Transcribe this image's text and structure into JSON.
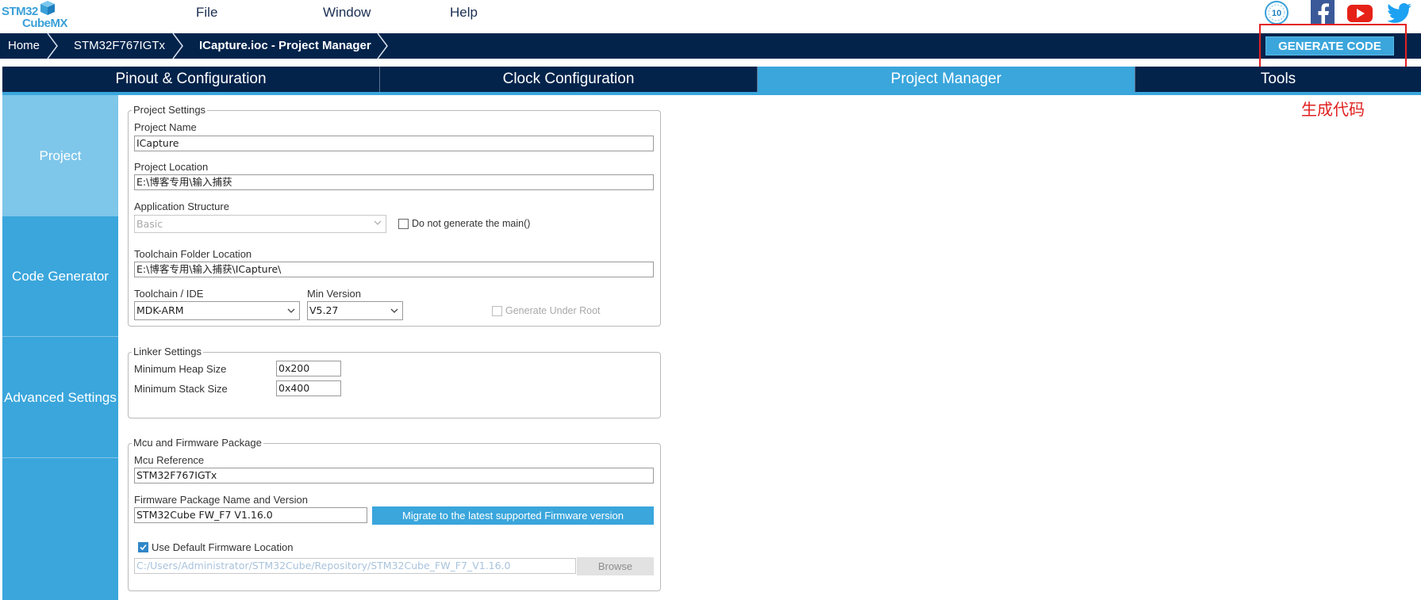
{
  "logo": {
    "line1": "STM32",
    "line2": "CubeMX"
  },
  "menu": {
    "file": "File",
    "window": "Window",
    "help": "Help"
  },
  "social": {
    "anniversary": "10",
    "facebook": "facebook-icon",
    "youtube": "youtube-icon",
    "twitter": "twitter-icon"
  },
  "breadcrumb": {
    "home": "Home",
    "mcu": "STM32F767IGTx",
    "project": "ICapture.ioc - Project Manager"
  },
  "generate_button": "GENERATE CODE",
  "annotation": "生成代码",
  "tabs": [
    "Pinout & Configuration",
    "Clock Configuration",
    "Project Manager",
    "Tools"
  ],
  "nav": [
    "Project",
    "Code Generator",
    "Advanced Settings"
  ],
  "project_settings": {
    "legend": "Project Settings",
    "name_label": "Project Name",
    "name_value": "ICapture",
    "location_label": "Project Location",
    "location_value": "E:\\博客专用\\输入捕获",
    "app_structure_label": "Application Structure",
    "app_structure_value": "Basic",
    "no_main_label": "Do not generate the main()",
    "toolchain_folder_label": "Toolchain Folder Location",
    "toolchain_folder_value": "E:\\博客专用\\输入捕获\\ICapture\\",
    "toolchain_label": "Toolchain / IDE",
    "toolchain_value": "MDK-ARM",
    "min_version_label": "Min Version",
    "min_version_value": "V5.27",
    "generate_root_label": "Generate Under Root"
  },
  "linker_settings": {
    "legend": "Linker Settings",
    "heap_label": "Minimum Heap Size",
    "heap_value": "0x200",
    "stack_label": "Minimum Stack Size",
    "stack_value": "0x400"
  },
  "firmware": {
    "legend": "Mcu and Firmware Package",
    "mcu_ref_label": "Mcu Reference",
    "mcu_ref_value": "STM32F767IGTx",
    "pkg_label": "Firmware Package Name and Version",
    "pkg_value": "STM32Cube FW_F7 V1.16.0",
    "migrate_button": "Migrate to the latest supported Firmware version",
    "use_default_label": "Use Default Firmware Location",
    "location_value": "C:/Users/Administrator/STM32Cube/Repository/STM32Cube_FW_F7_V1.16.0",
    "browse_button": "Browse"
  },
  "colors": {
    "navy": "#03234b",
    "accent": "#3aa6dc",
    "active_nav": "#7ec6ea",
    "highlight": "#e42020"
  }
}
